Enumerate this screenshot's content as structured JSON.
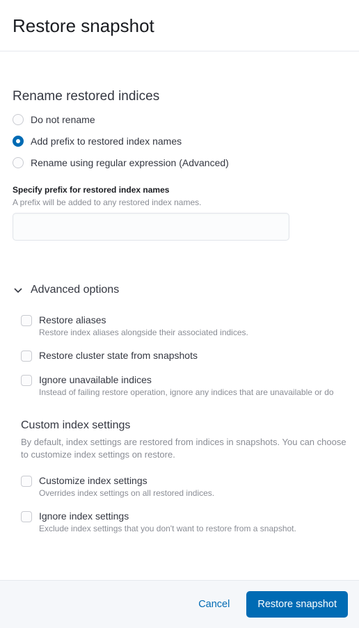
{
  "header": {
    "title": "Restore snapshot"
  },
  "rename": {
    "title": "Rename restored indices",
    "options": [
      {
        "label": "Do not rename"
      },
      {
        "label": "Add prefix to restored index names"
      },
      {
        "label": "Rename using regular expression (Advanced)"
      }
    ],
    "selected": 1,
    "prefix": {
      "label": "Specify prefix for restored index names",
      "help": "A prefix will be added to any restored index names.",
      "value": ""
    }
  },
  "advanced": {
    "title": "Advanced options",
    "checkboxes": [
      {
        "label": "Restore aliases",
        "desc": "Restore index aliases alongside their associated indices."
      },
      {
        "label": "Restore cluster state from snapshots",
        "desc": ""
      },
      {
        "label": "Ignore unavailable indices",
        "desc": "Instead of failing restore operation, ignore any indices that are unavailable or do"
      }
    ]
  },
  "custom": {
    "title": "Custom index settings",
    "desc": "By default, index settings are restored from indices in snapshots. You can choose to customize index settings on restore.",
    "checkboxes": [
      {
        "label": "Customize index settings",
        "desc": "Overrides index settings on all restored indices."
      },
      {
        "label": "Ignore index settings",
        "desc": "Exclude index settings that you don't want to restore from a snapshot."
      }
    ]
  },
  "footer": {
    "cancel": "Cancel",
    "submit": "Restore snapshot"
  }
}
